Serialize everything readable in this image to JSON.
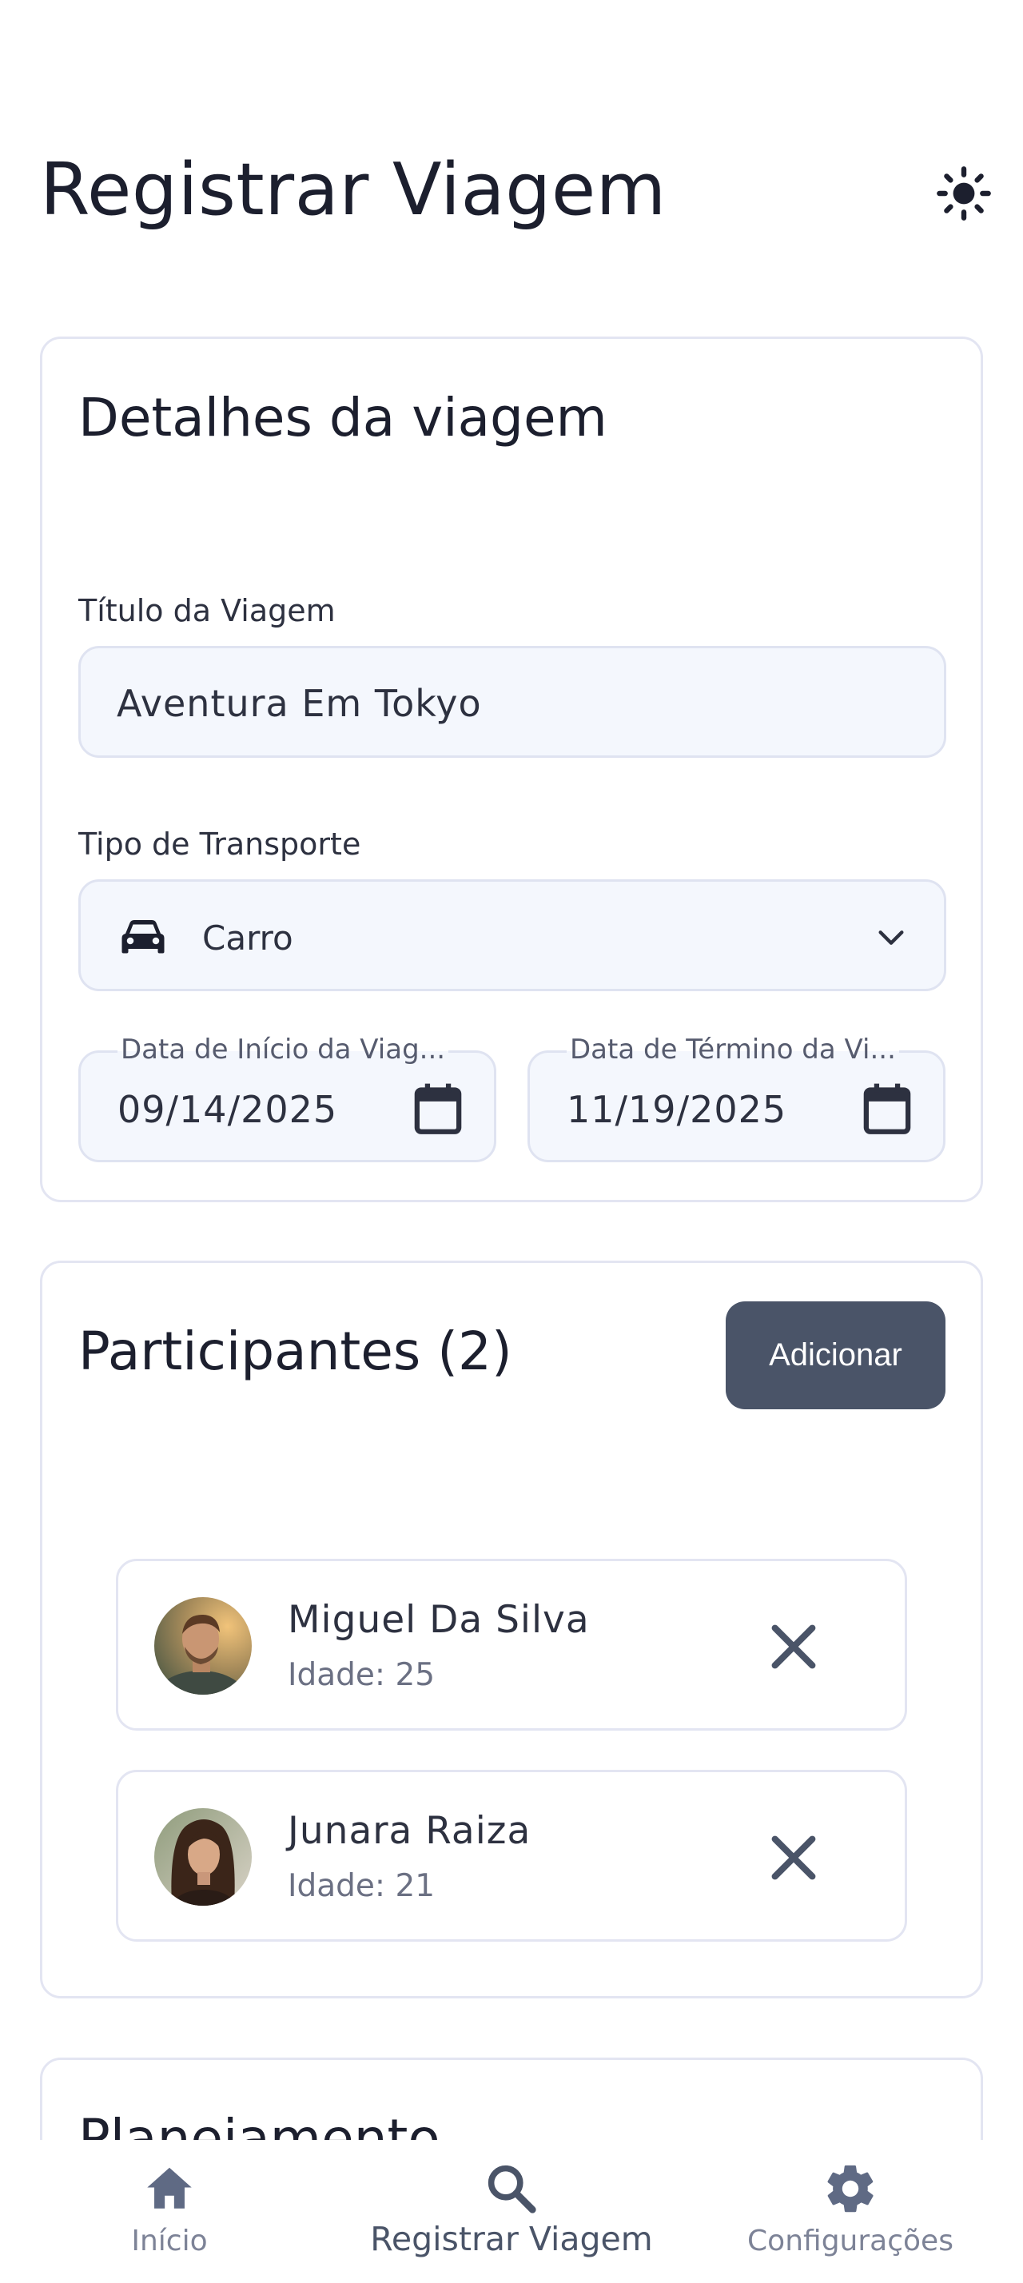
{
  "header": {
    "title": "Registrar Viagem",
    "theme_icon": "sun-icon"
  },
  "details": {
    "title": "Detalhes da viagem",
    "trip_title_label": "Título da Viagem",
    "trip_title_value": "Aventura Em Tokyo",
    "transport_label": "Tipo de Transporte",
    "transport_value": "Carro",
    "transport_icon": "car-icon",
    "start_date_label": "Data de Início da Viag...",
    "start_date_value": "09/14/2025",
    "end_date_label": "Data de Término da Vi...",
    "end_date_value": "11/19/2025"
  },
  "participants": {
    "title": "Participantes (2)",
    "add_label": "Adicionar",
    "items": [
      {
        "name": "Miguel Da Silva",
        "age": "Idade: 25"
      },
      {
        "name": "Junara Raiza",
        "age": "Idade: 21"
      }
    ]
  },
  "planning": {
    "title": "Planejamento"
  },
  "nav": {
    "items": [
      {
        "label": "Início",
        "icon": "home-icon"
      },
      {
        "label": "Registrar Viagem",
        "icon": "search-icon",
        "active": true
      },
      {
        "label": "Configurações",
        "icon": "gear-icon"
      }
    ]
  },
  "colors": {
    "accent": "#4a5468",
    "field_bg": "#f4f7fd",
    "border": "#e3e5f2",
    "text": "#1c1f2e"
  }
}
